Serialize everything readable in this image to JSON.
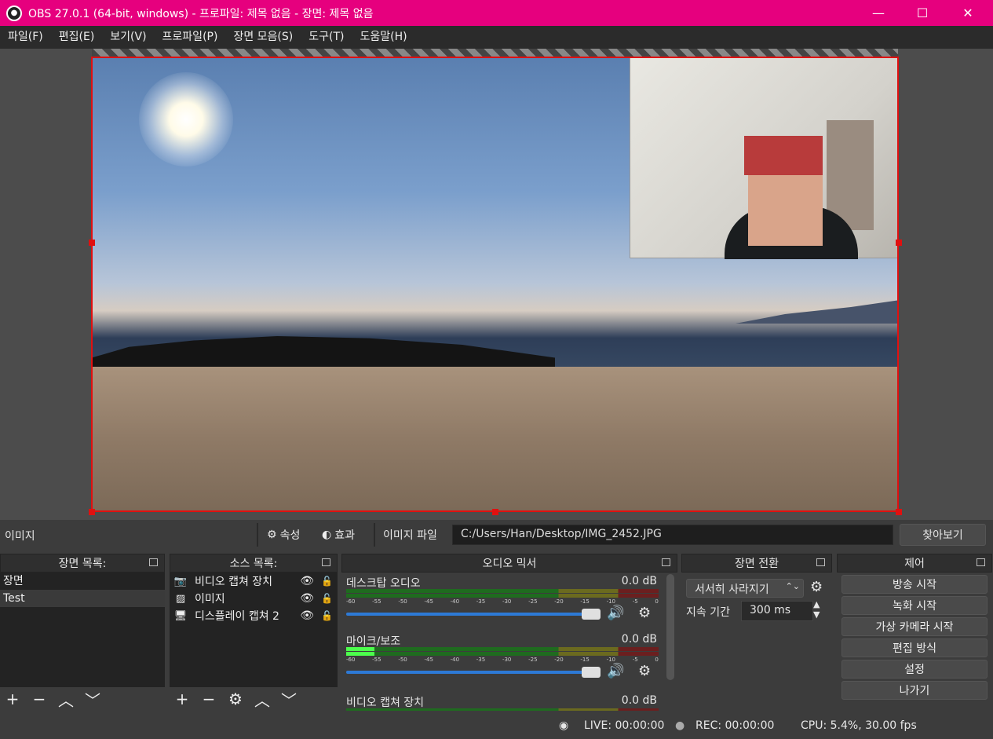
{
  "window": {
    "title": "OBS 27.0.1 (64-bit, windows) - 프로파일: 제목 없음 - 장면: 제목 없음",
    "title_bar_color": "#e6007e"
  },
  "menu": [
    "파일(F)",
    "편집(E)",
    "보기(V)",
    "프로파일(P)",
    "장면 모음(S)",
    "도구(T)",
    "도움말(H)"
  ],
  "properties_bar": {
    "source_name": "이미지",
    "properties_label": "속성",
    "filters_label": "효과",
    "image_file_label": "이미지 파일",
    "image_path": "C:/Users/Han/Desktop/IMG_2452.JPG",
    "browse_label": "찾아보기"
  },
  "scenes": {
    "title": "장면 목록:",
    "items": [
      "장면",
      "Test"
    ]
  },
  "sources": {
    "title": "소스 목록:",
    "items": [
      {
        "label": "비디오 캡쳐 장치",
        "icon": "camera-icon"
      },
      {
        "label": "이미지",
        "icon": "image-icon"
      },
      {
        "label": "디스플레이 캡쳐 2",
        "icon": "monitor-icon"
      }
    ]
  },
  "mixer": {
    "title": "오디오 믹서",
    "channels": [
      {
        "name": "데스크탑 오디오",
        "db": "0.0 dB",
        "level": 0.0
      },
      {
        "name": "마이크/보조",
        "db": "0.0 dB",
        "level": 0.09
      },
      {
        "name": "비디오 캡쳐 장치",
        "db": "0.0 dB",
        "level": 0.0
      }
    ],
    "ticks": [
      "-60",
      "-55",
      "-50",
      "-45",
      "-40",
      "-35",
      "-30",
      "-25",
      "-20",
      "-15",
      "-10",
      "-5",
      "0"
    ]
  },
  "transitions": {
    "title": "장면 전환",
    "selected": "서서히 사라지기",
    "duration_label": "지속 기간",
    "duration_value": "300 ms"
  },
  "controls": {
    "title": "제어",
    "buttons": [
      "방송 시작",
      "녹화 시작",
      "가상 카메라 시작",
      "편집 방식",
      "설정",
      "나가기"
    ]
  },
  "status": {
    "live": "LIVE: 00:00:00",
    "rec": "REC: 00:00:00",
    "cpu": "CPU: 5.4%, 30.00 fps"
  },
  "colors": {
    "selection": "#e01010",
    "accent": "#2d7ad6"
  }
}
